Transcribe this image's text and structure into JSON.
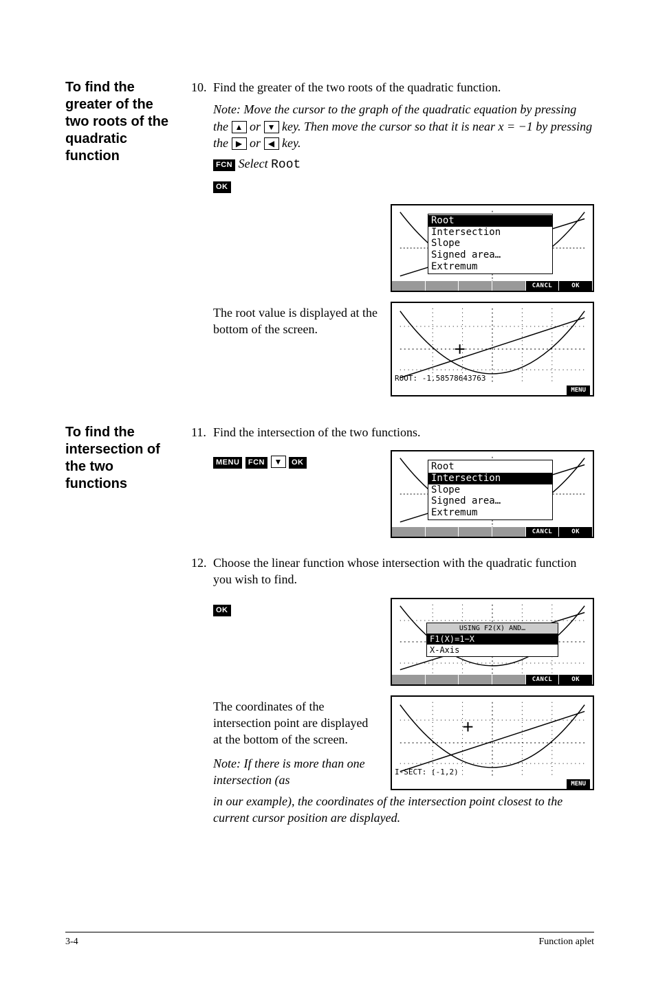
{
  "section1": {
    "heading": "To find the greater of the two roots of the quadratic function",
    "step_num": "10.",
    "step_text": "Find the greater of the two roots of the quadratic function.",
    "note_prefix": "Note: Move the cursor to the graph of the quadratic equation by pressing the",
    "note_mid1": " or ",
    "note_mid2": " key. Then move the cursor so that it is near ",
    "note_eq": "x = −1",
    "note_mid3": " by pressing the ",
    "note_mid4": " or ",
    "note_end": " key.",
    "key_up": "▲",
    "key_down": "▼",
    "key_right": "▶",
    "key_left": "◀",
    "softkey_fcn": "FCN",
    "select_label": "Select",
    "select_item": "Root",
    "softkey_ok": "OK",
    "popup": {
      "items": [
        "Root",
        "Intersection",
        "Slope",
        "Signed area…",
        "Extremum"
      ],
      "selected": 0
    },
    "softbar": {
      "cancl": "CANCL",
      "ok": "OK"
    },
    "result_text": "The root value is displayed at the bottom of the screen.",
    "root_value": "ROOT: -1.58578643763",
    "menu_label": "MENU"
  },
  "section2": {
    "heading": "To find the intersection of the two functions",
    "step11_num": "11.",
    "step11_text": "Find the intersection of the two functions.",
    "softkey_menu": "MENU",
    "softkey_fcn": "FCN",
    "key_down": "▼",
    "softkey_ok": "OK",
    "popup": {
      "items": [
        "Root",
        "Intersection",
        "Slope",
        "Signed area…",
        "Extremum"
      ],
      "selected": 1
    },
    "softbar": {
      "cancl": "CANCL",
      "ok": "OK"
    },
    "step12_num": "12.",
    "step12_text": "Choose the linear function whose intersection with the quadratic function you wish to find.",
    "softkey_ok2": "OK",
    "dlg": {
      "title": "USING F2(X) AND…",
      "opt1": "F1(X)=1−X",
      "opt2": "X-Axis"
    },
    "softbar2": {
      "cancl": "CANCL",
      "ok": "OK"
    },
    "result_text": "The coordinates of the intersection point are displayed at the bottom of the screen.",
    "isect_value": "I-SECT: (-1,2)",
    "menu_label": "MENU",
    "note_tail1": "Note: If there is more than one intersection (as",
    "note_tail2": "in our example), the coordinates of the intersection point closest to the current cursor position are displayed."
  },
  "footer": {
    "page": "3-4",
    "label": "Function aplet"
  }
}
